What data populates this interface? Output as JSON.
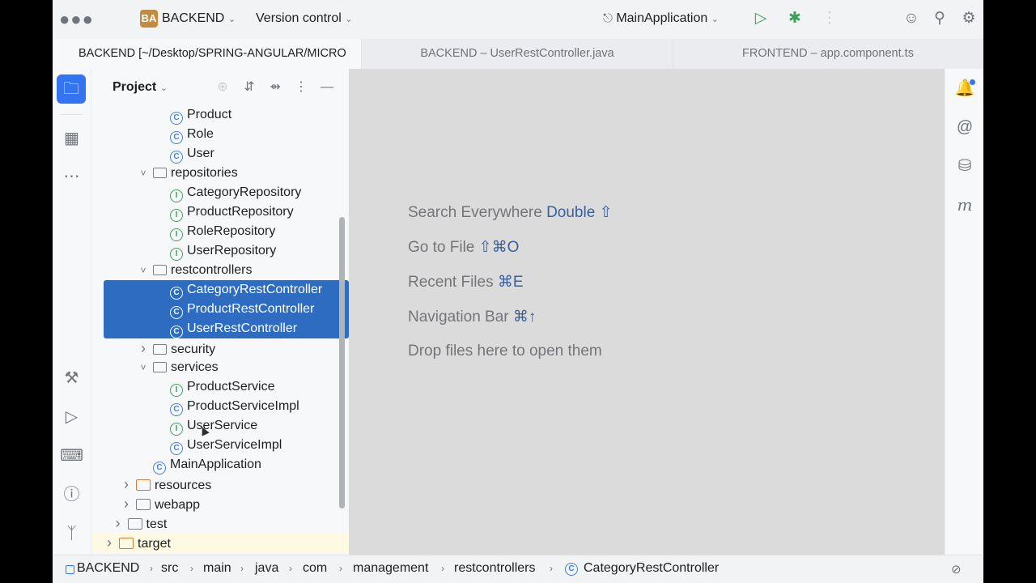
{
  "titlebar": {
    "project_badge": "BA",
    "project_name": "BACKEND",
    "vcs_label": "Version control",
    "run_config": "MainApplication"
  },
  "tabs": [
    {
      "label": "BACKEND [~/Desktop/SPRING-ANGULAR/MICRO",
      "active": true
    },
    {
      "label": "BACKEND – UserRestController.java",
      "active": false
    },
    {
      "label": "FRONTEND – app.component.ts",
      "active": false
    }
  ],
  "panel": {
    "title": "Project"
  },
  "tree": [
    {
      "label": "Product",
      "kind": "class",
      "indent": 3,
      "arrow": ""
    },
    {
      "label": "Role",
      "kind": "class",
      "indent": 3,
      "arrow": ""
    },
    {
      "label": "User",
      "kind": "class",
      "indent": 3,
      "arrow": ""
    },
    {
      "label": "repositories",
      "kind": "pkg",
      "indent": 2,
      "arrow": "down"
    },
    {
      "label": "CategoryRepository",
      "kind": "iface",
      "indent": 3,
      "arrow": ""
    },
    {
      "label": "ProductRepository",
      "kind": "iface",
      "indent": 3,
      "arrow": ""
    },
    {
      "label": "RoleRepository",
      "kind": "iface",
      "indent": 3,
      "arrow": ""
    },
    {
      "label": "UserRepository",
      "kind": "iface",
      "indent": 3,
      "arrow": ""
    },
    {
      "label": "restcontrollers",
      "kind": "pkg",
      "indent": 2,
      "arrow": "down"
    },
    {
      "label": "CategoryRestController",
      "kind": "class",
      "indent": 3,
      "arrow": "",
      "selected": true
    },
    {
      "label": "ProductRestController",
      "kind": "class",
      "indent": 3,
      "arrow": "",
      "selected": true
    },
    {
      "label": "UserRestController",
      "kind": "class",
      "indent": 3,
      "arrow": "",
      "selected": true
    },
    {
      "label": "security",
      "kind": "pkg",
      "indent": 2,
      "arrow": "right"
    },
    {
      "label": "services",
      "kind": "pkg",
      "indent": 2,
      "arrow": "down"
    },
    {
      "label": "ProductService",
      "kind": "iface",
      "indent": 3,
      "arrow": ""
    },
    {
      "label": "ProductServiceImpl",
      "kind": "class",
      "indent": 3,
      "arrow": ""
    },
    {
      "label": "UserService",
      "kind": "iface",
      "indent": 3,
      "arrow": ""
    },
    {
      "label": "UserServiceImpl",
      "kind": "class",
      "indent": 3,
      "arrow": ""
    },
    {
      "label": "MainApplication",
      "kind": "app",
      "indent": 2,
      "arrow": ""
    },
    {
      "label": "resources",
      "kind": "folder-o",
      "indent": 1,
      "arrow": "right"
    },
    {
      "label": "webapp",
      "kind": "folder",
      "indent": 1,
      "arrow": "right"
    },
    {
      "label": "test",
      "kind": "folder",
      "indent": 0.5,
      "arrow": "right"
    },
    {
      "label": "target",
      "kind": "folder-o",
      "indent": 0,
      "arrow": "right"
    }
  ],
  "editor_hints": [
    {
      "text": "Search Everywhere ",
      "key": "Double ⇧"
    },
    {
      "text": "Go to File ",
      "key": "⇧⌘O"
    },
    {
      "text": "Recent Files ",
      "key": "⌘E"
    },
    {
      "text": "Navigation Bar ",
      "key": "⌘↑"
    },
    {
      "text": "Drop files here to open them",
      "key": ""
    }
  ],
  "breadcrumbs": [
    "BACKEND",
    "src",
    "main",
    "java",
    "com",
    "management",
    "restcontrollers",
    "CategoryRestController"
  ],
  "colors": {
    "accent": "#3574f0",
    "selection": "#2d6cc0",
    "editor_bg": "#dbdbdc"
  }
}
